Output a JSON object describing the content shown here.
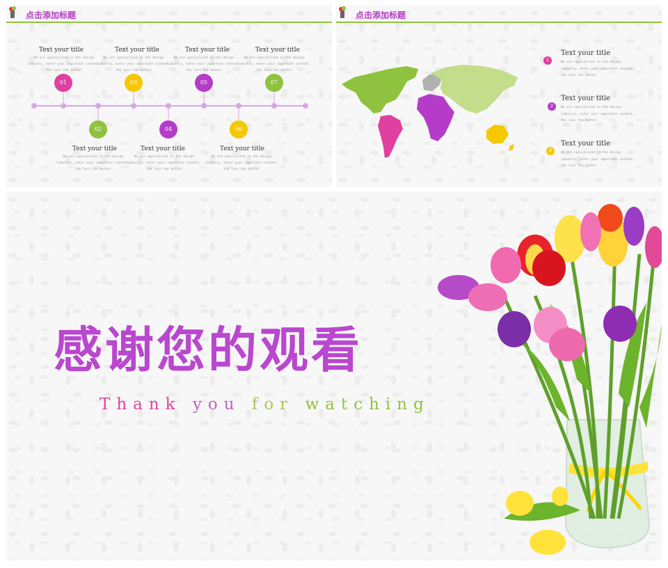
{
  "slide1": {
    "header_title": "点击添加标题",
    "items": [
      {
        "num": "01",
        "title": "Text your title",
        "body": "We are specialized in the design industry, enter your important content, the less the better",
        "color": "#e040a0"
      },
      {
        "num": "02",
        "title": "Text your title",
        "body": "We are specialized in the design industry, enter your important content, the less the better",
        "color": "#8fc23e"
      },
      {
        "num": "03",
        "title": "Text your title",
        "body": "We are specialized in the design industry, enter your important content, the less the better",
        "color": "#f5c800"
      },
      {
        "num": "04",
        "title": "Text your title",
        "body": "We are specialized in the design industry, enter your important content, the less the better",
        "color": "#b43cc8"
      },
      {
        "num": "05",
        "title": "Text your title",
        "body": "We are specialized in the design industry, enter your important content, the less the better",
        "color": "#b43cc8"
      },
      {
        "num": "06",
        "title": "Text your title",
        "body": "We are specialized in the design industry, enter your important content, the less the better",
        "color": "#f5c800"
      },
      {
        "num": "07",
        "title": "Text your title",
        "body": "We are specialized in the design industry, enter your important content, the less the better",
        "color": "#8fc23e"
      }
    ]
  },
  "slide2": {
    "header_title": "点击添加标题",
    "items": [
      {
        "num": "1",
        "title": "Text your title",
        "body": "We are specialized in the design industry, enter your important content, the less the better",
        "color": "#e040a0"
      },
      {
        "num": "2",
        "title": "Text your title",
        "body": "We are specialized in the design industry, enter your important content, the less the better",
        "color": "#b43cc8"
      },
      {
        "num": "3",
        "title": "Text your title",
        "body": "We are specialized in the design industry, enter your important content, the less the better",
        "color": "#f5c800"
      }
    ],
    "map_colors": {
      "americas_north": "#8fc23e",
      "americas_south": "#e040a0",
      "europe": "#b0b0b0",
      "africa": "#b43cc8",
      "asia": "#c3dd8a",
      "oceania": "#f5c800"
    }
  },
  "slide3": {
    "title_cn": "感谢您的观看",
    "subtitle": [
      {
        "text": "Thank",
        "color": "#e040a0"
      },
      {
        "text": "you",
        "color": "#c060c8"
      },
      {
        "text": "for",
        "color": "#a8c85a"
      },
      {
        "text": "watching",
        "color": "#8fc23e"
      }
    ]
  },
  "colors": {
    "accent_green": "#8fc23e",
    "accent_purple": "#b43cc8",
    "accent_pink": "#e040a0",
    "accent_yellow": "#f5c800"
  }
}
